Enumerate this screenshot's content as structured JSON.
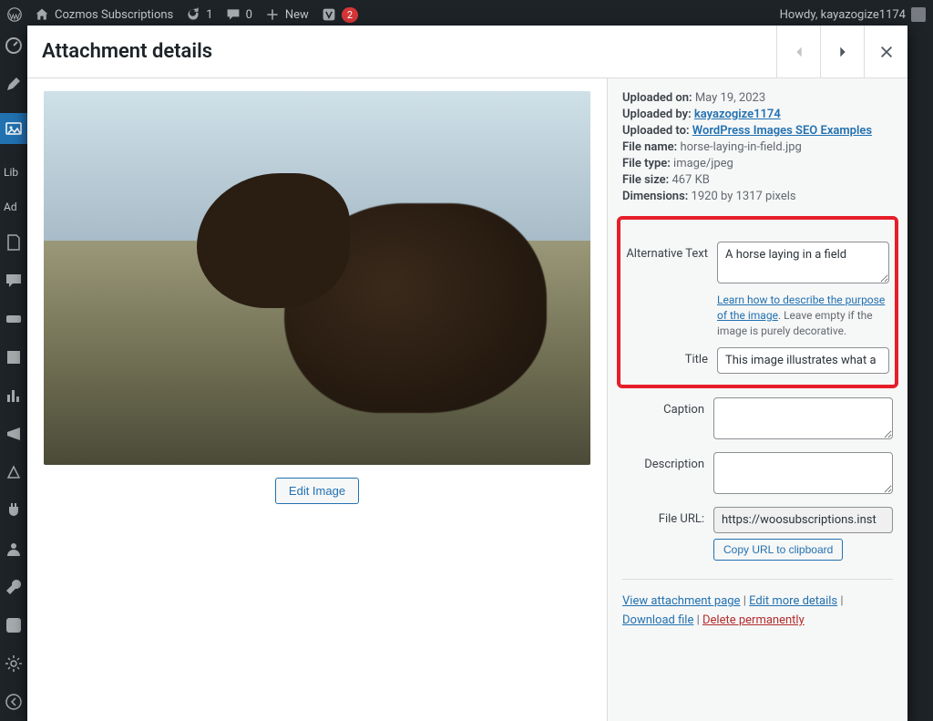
{
  "adminBar": {
    "siteName": "Cozmos Subscriptions",
    "updates": "1",
    "comments": "0",
    "newLabel": "New",
    "yoastCount": "2",
    "howdy": "Howdy, kayazogize1174"
  },
  "sidebar": {
    "libLabel": "Lib",
    "addLabel": "Ad"
  },
  "modal": {
    "title": "Attachment details"
  },
  "meta": {
    "uploadedOnLabel": "Uploaded on:",
    "uploadedOn": "May 19, 2023",
    "uploadedByLabel": "Uploaded by:",
    "uploadedBy": "kayazogize1174",
    "uploadedToLabel": "Uploaded to:",
    "uploadedTo": "WordPress Images SEO Examples",
    "fileNameLabel": "File name:",
    "fileName": "horse-laying-in-field.jpg",
    "fileTypeLabel": "File type:",
    "fileType": "image/jpeg",
    "fileSizeLabel": "File size:",
    "fileSize": "467 KB",
    "dimensionsLabel": "Dimensions:",
    "dimensions": "1920 by 1317 pixels"
  },
  "fields": {
    "altLabel": "Alternative Text",
    "altValue": "A horse laying in a field",
    "altHelpLink": "Learn how to describe the purpose of the image",
    "altHelpRest": ". Leave empty if the image is purely decorative.",
    "titleLabel": "Title",
    "titleValue": "This image illustrates what a",
    "captionLabel": "Caption",
    "captionValue": "",
    "descLabel": "Description",
    "descValue": "",
    "urlLabel": "File URL:",
    "urlValue": "https://woosubscriptions.inst",
    "copyBtn": "Copy URL to clipboard"
  },
  "editImage": "Edit Image",
  "links": {
    "viewPage": "View attachment page",
    "editMore": "Edit more details",
    "download": "Download file",
    "delete": "Delete permanently"
  }
}
